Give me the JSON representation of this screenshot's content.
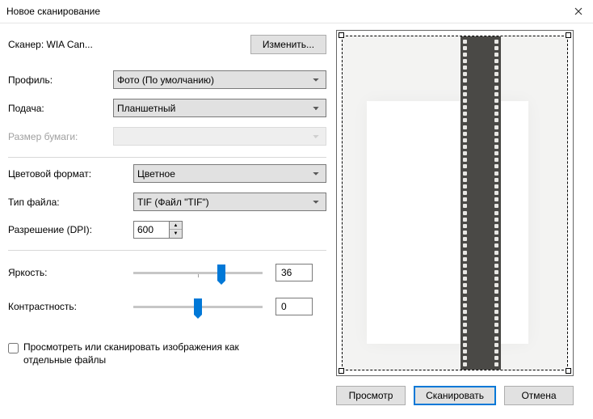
{
  "title": "Новое сканирование",
  "scanner": {
    "label": "Сканер: WIA Can...",
    "change_label": "Изменить..."
  },
  "profile": {
    "label": "Профиль:",
    "value": "Фото (По умолчанию)"
  },
  "source": {
    "label": "Подача:",
    "value": "Планшетный"
  },
  "paper": {
    "label": "Размер бумаги:",
    "value": ""
  },
  "colorfmt": {
    "label": "Цветовой формат:",
    "value": "Цветное"
  },
  "filetype": {
    "label": "Тип файла:",
    "value": "TIF (Файл \"TIF\")"
  },
  "dpi": {
    "label": "Разрешение (DPI):",
    "value": "600"
  },
  "brightness": {
    "label": "Яркость:",
    "value": "36",
    "percent": 68
  },
  "contrast": {
    "label": "Контрастность:",
    "value": "0",
    "percent": 50
  },
  "separate": {
    "label": "Просмотреть или сканировать изображения как отдельные файлы"
  },
  "buttons": {
    "preview": "Просмотр",
    "scan": "Сканировать",
    "cancel": "Отмена"
  }
}
